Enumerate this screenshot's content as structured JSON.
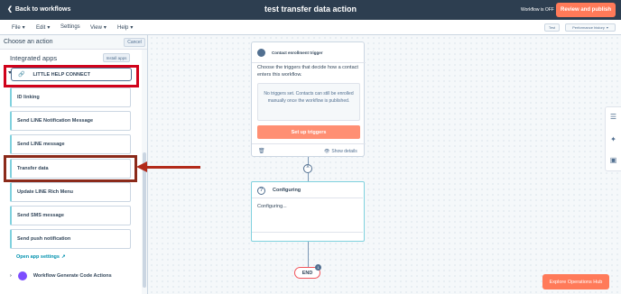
{
  "header": {
    "back_label": "Back to workflows",
    "title": "test transfer data action",
    "status": "Workflow is OFF",
    "review_label": "Review and publish"
  },
  "menu": {
    "items": [
      {
        "label": "File"
      },
      {
        "label": "Edit"
      },
      {
        "label": "Settings"
      },
      {
        "label": "View"
      },
      {
        "label": "Help"
      }
    ],
    "test_label": "Test",
    "performance_label": "Performance history"
  },
  "panel": {
    "title": "Choose an action",
    "cancel_label": "Cancel",
    "section_title": "Integrated apps",
    "install_label": "Install apps",
    "app_name": "LITTLE HELP CONNECT",
    "actions": [
      {
        "label": "ID linking"
      },
      {
        "label": "Send LINE Notification Message"
      },
      {
        "label": "Send LINE message"
      },
      {
        "label": "Transfer data"
      },
      {
        "label": "Update LINE Rich Menu"
      },
      {
        "label": "Send SMS message"
      },
      {
        "label": "Send push notification"
      }
    ],
    "open_settings_label": "Open app settings",
    "generate_code_label": "Workflow Generate Code Actions"
  },
  "trigger": {
    "title": "Contact enrollment trigger",
    "description": "Choose the triggers that decide how a contact enters this workflow.",
    "empty_message": "No triggers set. Contacts can still be enrolled manually once the workflow is published.",
    "setup_label": "Set up triggers",
    "show_details_label": "Show details"
  },
  "config": {
    "title": "Configuring",
    "body": "Configuring..."
  },
  "end_label": "END",
  "end_badge": "1",
  "explore_label": "Explore Operations Hub",
  "colors": {
    "header_bg": "#2d3e50",
    "accent_orange": "#ff7a59",
    "annotation_red": "#d0021b",
    "annotation_brown": "#8b2a1a"
  }
}
